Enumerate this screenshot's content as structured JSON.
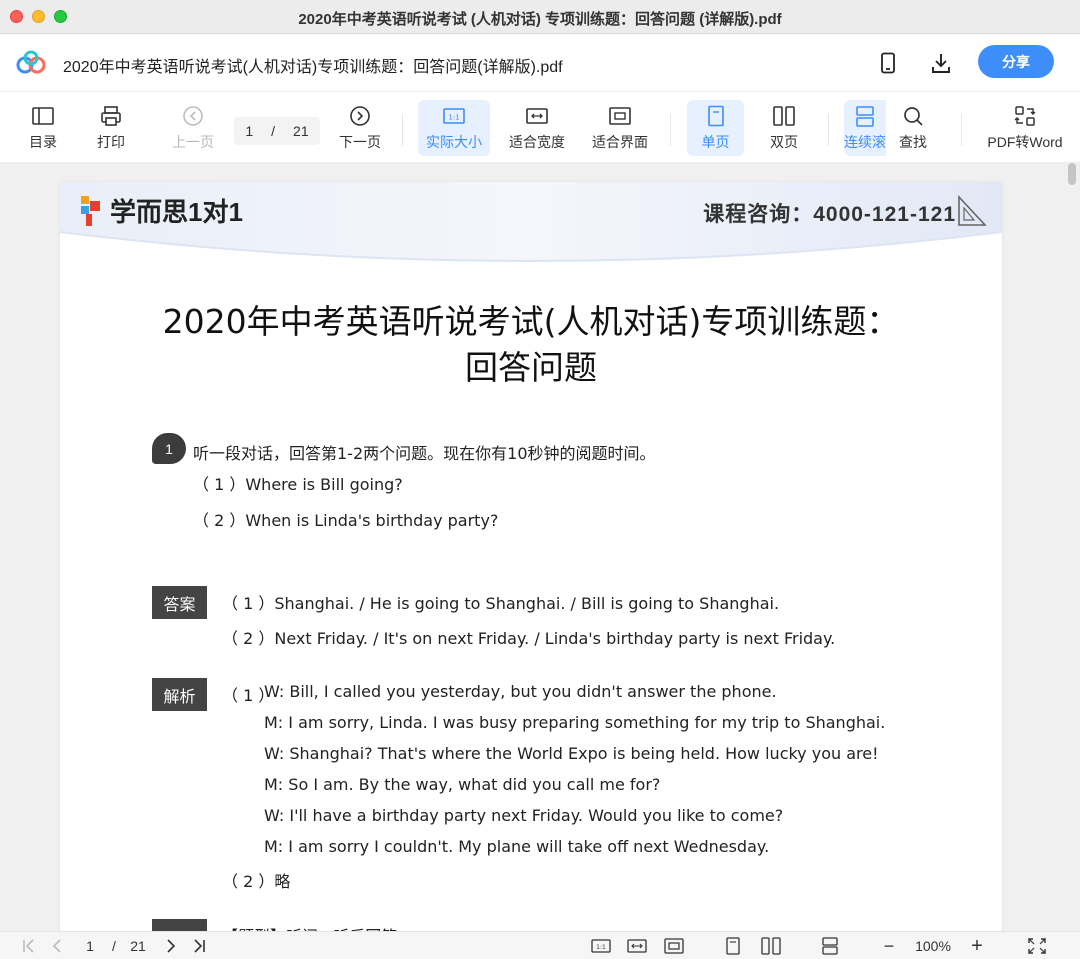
{
  "window": {
    "title": "2020年中考英语听说考试 (人机对话) 专项训练题：回答问题 (详解版).pdf"
  },
  "appbar": {
    "doc_title": "2020年中考英语听说考试(人机对话)专项训练题：回答问题(详解版).pdf",
    "share_label": "分享",
    "icons": [
      "app-logo-icon",
      "phone-icon",
      "download-icon"
    ]
  },
  "toolbar": {
    "toc": "目录",
    "print": "打印",
    "prev": "上一页",
    "page_current": "1",
    "page_sep": "/",
    "page_total": "21",
    "next": "下一页",
    "actual_size": "实际大小",
    "fit_width": "适合宽度",
    "fit_page": "适合界面",
    "single": "单页",
    "double": "双页",
    "continuous": "连续滚",
    "search": "查找",
    "pdf_to_word": "PDF转Word",
    "accent_color": "#3d8ef8"
  },
  "document": {
    "brand": "学而思1对1",
    "hotline": "课程咨询：4000-121-121",
    "heading_line1": "2020年中考英语听说考试(人机对话)专项训练题：",
    "heading_line2": "回答问题",
    "question_number": "1",
    "question_prompt": "听一段对话，回答第1-2两个问题。现在你有10秒钟的阅题时间。",
    "questions": [
      "（ 1 ）Where is Bill going?",
      "（ 2 ）When is Linda's birthday party?"
    ],
    "answer_tag": "答案",
    "answers": [
      "（ 1 ）Shanghai. / He is going to Shanghai. / Bill is going to Shanghai.",
      "（ 2 ）Next Friday. / It's on next Friday. / Linda's birthday party is next Friday."
    ],
    "analysis_tag": "解析",
    "analysis_prefix_1": "（ 1 ）",
    "analysis_lines": [
      "W: Bill, I called you yesterday, but you didn't answer the phone.",
      "M: I am sorry, Linda. I was busy preparing something for my trip to Shanghai.",
      "W: Shanghai? That's where the World Expo is being held. How lucky you are!",
      "M: So I am. By the way, what did you call me for?",
      "W: I'll have a birthday party next Friday. Would you like to come?",
      "M: I am sorry I couldn't. My plane will take off next Wednesday."
    ],
    "analysis_2": "（ 2 ）略",
    "cutoff_line": "【题型】听问 · 听后回答"
  },
  "statusbar": {
    "page_current": "1",
    "page_sep": "/",
    "page_total": "21",
    "zoom": "100%",
    "zoom_out": "−",
    "zoom_in": "+"
  }
}
